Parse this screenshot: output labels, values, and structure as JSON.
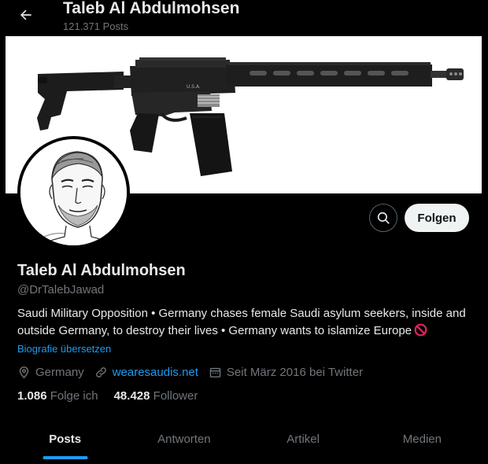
{
  "header": {
    "title": "Taleb Al Abdulmohsen",
    "post_count": "121.371 Posts",
    "back_icon": "arrow-left-icon"
  },
  "banner": {
    "description_icon": "rifle-image"
  },
  "profile": {
    "display_name": "Taleb Al Abdulmohsen",
    "handle": "@DrTalebJawad",
    "bio": "Saudi Military Opposition • Germany chases female Saudi asylum seekers, inside and outside Germany, to destroy their lives • Germany wants to islamize Europe",
    "translate_label": "Biografie übersetzen",
    "location": "Germany",
    "website": "wearesaudis.net",
    "joined": "Seit März 2016 bei Twitter"
  },
  "actions": {
    "search_icon": "search-icon",
    "follow_label": "Folgen"
  },
  "stats": {
    "following_count": "1.086",
    "following_label": "Folge ich",
    "followers_count": "48.428",
    "followers_label": "Follower"
  },
  "tabs": [
    {
      "label": "Posts",
      "active": true
    },
    {
      "label": "Antworten",
      "active": false
    },
    {
      "label": "Artikel",
      "active": false
    },
    {
      "label": "Medien",
      "active": false
    }
  ],
  "colors": {
    "background": "#000000",
    "accent": "#1d9bf0",
    "text_primary": "#e7e9ea",
    "text_secondary": "#71767b",
    "follow_bg": "#eff3f4"
  }
}
